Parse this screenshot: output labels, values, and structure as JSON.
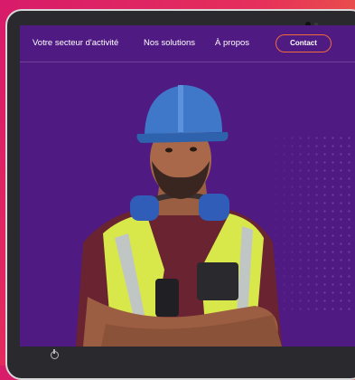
{
  "nav": {
    "items": [
      {
        "label": "Votre secteur d'activité"
      },
      {
        "label": "Nos solutions"
      },
      {
        "label": "À propos"
      }
    ],
    "contact_label": "Contact"
  },
  "hero": {
    "image": "construction-worker-photo"
  },
  "colors": {
    "background_gradient": [
      "#d81b6a",
      "#f08a2c"
    ],
    "screen": "#4f1a82",
    "accent": "#f06a3b"
  },
  "icons": {
    "power": "power-icon"
  }
}
